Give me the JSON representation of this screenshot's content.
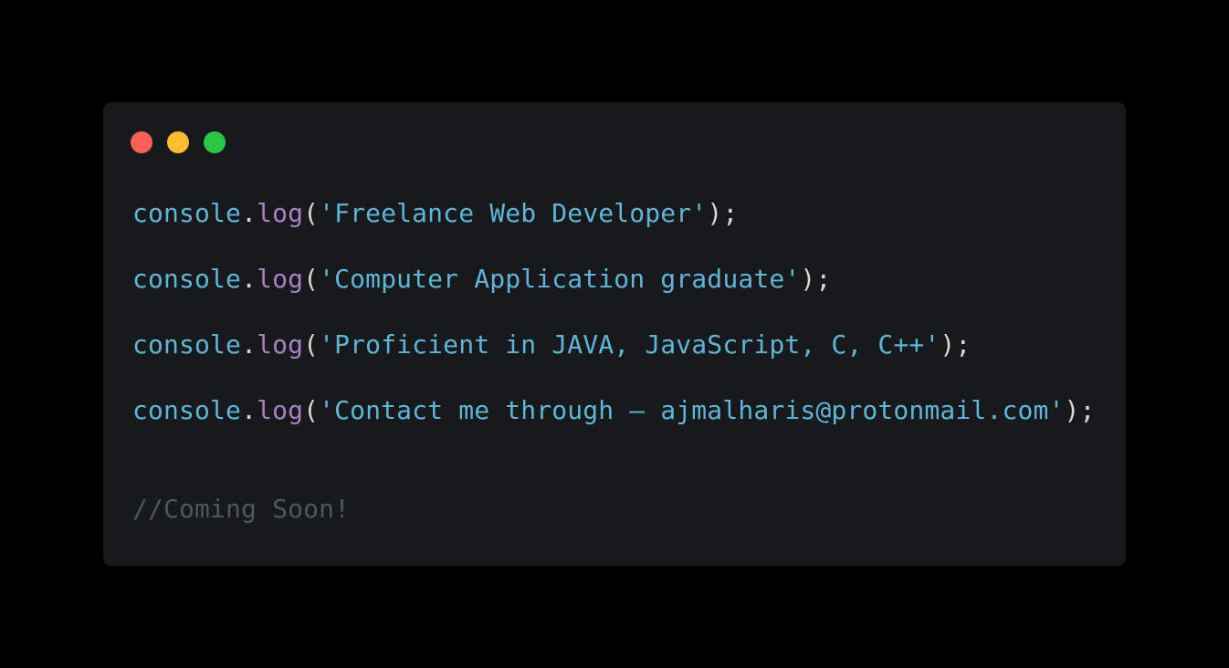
{
  "window": {
    "traffic_lights": [
      {
        "name": "close",
        "color": "#ff5f57"
      },
      {
        "name": "minimize",
        "color": "#febc2e"
      },
      {
        "name": "maximize",
        "color": "#28c840"
      }
    ]
  },
  "colors": {
    "background": "#000000",
    "panel": "#18191b",
    "object": "#5eb5da",
    "function": "#a97fc7",
    "string": "#5eb5da",
    "punctuation": "#d7d7d7",
    "comment": "#4d575f"
  },
  "code": {
    "lines": [
      {
        "object": "console",
        "dot": ".",
        "method": "log",
        "open": "(",
        "string": "'Freelance Web Developer'",
        "close": ");"
      },
      {
        "object": "console",
        "dot": ".",
        "method": "log",
        "open": "(",
        "string": "'Computer Application graduate'",
        "close": ");"
      },
      {
        "object": "console",
        "dot": ".",
        "method": "log",
        "open": "(",
        "string": "'Proficient in JAVA, JavaScript, C, C++'",
        "close": ");"
      },
      {
        "object": "console",
        "dot": ".",
        "method": "log",
        "open": "(",
        "string": "'Contact me through – ajmalharis@protonmail.com'",
        "close": ");"
      }
    ],
    "comment": "//Coming Soon!"
  }
}
